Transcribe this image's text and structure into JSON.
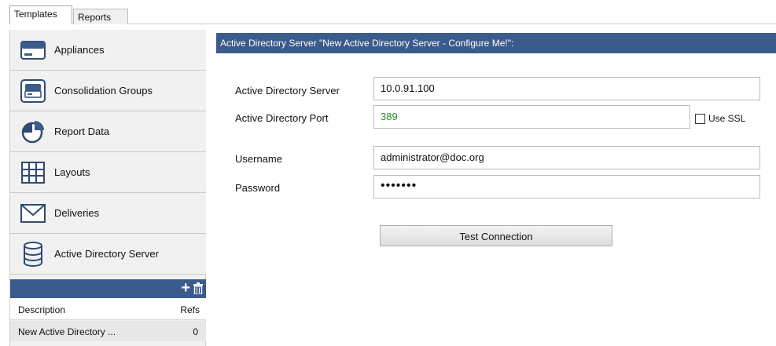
{
  "tabs": [
    {
      "label": "Templates",
      "active": true
    },
    {
      "label": "Reports",
      "active": false
    }
  ],
  "nav": {
    "items": [
      {
        "label": "Appliances",
        "icon": "appliance-icon"
      },
      {
        "label": "Consolidation Groups",
        "icon": "consolidation-group-icon"
      },
      {
        "label": "Report Data",
        "icon": "pie-chart-icon"
      },
      {
        "label": "Layouts",
        "icon": "grid-layout-icon"
      },
      {
        "label": "Deliveries",
        "icon": "envelope-icon"
      },
      {
        "label": "Active Directory Server",
        "icon": "database-icon"
      }
    ]
  },
  "list": {
    "toolbar": {
      "add_icon": "plus-icon",
      "delete_icon": "trash-icon"
    },
    "columns": [
      "Description",
      "Refs"
    ],
    "rows": [
      {
        "description": "New Active Directory ...",
        "refs": "0"
      }
    ]
  },
  "form": {
    "header": "Active Directory Server \"New Active Directory Server - Configure Me!\":",
    "server_label": "Active Directory Server",
    "server_value": "10.0.91.100",
    "port_label": "Active Directory Port",
    "port_value": "389",
    "use_ssl_label": "Use SSL",
    "use_ssl_checked": false,
    "username_label": "Username",
    "username_value": "administrator@doc.org",
    "password_label": "Password",
    "password_value": "•••••••",
    "test_button": "Test Connection"
  },
  "colors": {
    "accent": "#3b5b8c",
    "port_text": "#2a8a2a",
    "selected_row": "#e7e7e7"
  }
}
